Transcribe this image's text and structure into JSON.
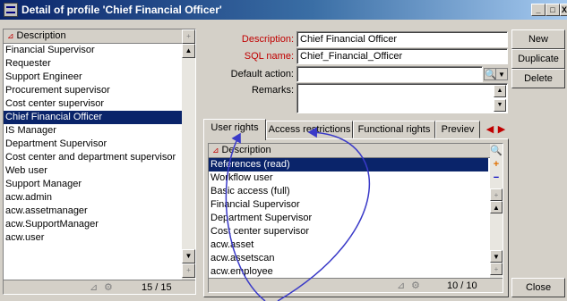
{
  "window": {
    "title": "Detail of profile 'Chief Financial Officer'",
    "buttons": [
      "_",
      "□",
      "X"
    ]
  },
  "left_list": {
    "header": "Description",
    "items": [
      "Financial Supervisor",
      "Requester",
      "Support Engineer",
      "Procurement supervisor",
      "Cost center supervisor",
      "Chief Financial Officer",
      "IS Manager",
      "Department Supervisor",
      "Cost center and department supervisor",
      "Web user",
      "Support Manager",
      "acw.admin",
      "acw.assetmanager",
      "acw.SupportManager",
      "acw.user"
    ],
    "selected_index": 5,
    "count": "15 / 15"
  },
  "form": {
    "description_label": "Description:",
    "description_value": "Chief Financial Officer",
    "sqlname_label": "SQL name:",
    "sqlname_value": "Chief_Financial_Officer",
    "default_action_label": "Default action:",
    "default_action_value": "",
    "remarks_label": "Remarks:",
    "remarks_value": ""
  },
  "buttons": {
    "new": "New",
    "duplicate": "Duplicate",
    "delete": "Delete",
    "close": "Close"
  },
  "tabs": [
    "User rights",
    "Access restrictions",
    "Functional rights",
    "Previev"
  ],
  "active_tab": 0,
  "rights_list": {
    "header": "Description",
    "items": [
      "References (read)",
      "Workflow user",
      "Basic access (full)",
      "Financial Supervisor",
      "Department Supervisor",
      "Cost center supervisor",
      "acw.asset",
      "acw.assetscan",
      "acw.employee"
    ],
    "selected_index": 0,
    "count": "10 / 10"
  },
  "colors": {
    "title_gradient_start": "#0a246a",
    "selection": "#0a246a",
    "required_label": "#c00000",
    "annotation_arrow": "#3a3ac8"
  },
  "icons": [
    "app-icon",
    "sort-icon",
    "search-icon",
    "add-icon",
    "remove-icon",
    "zoom-icon",
    "dropdown-icon",
    "filter-icon",
    "tab-scroll-left-icon",
    "tab-scroll-right-icon"
  ]
}
